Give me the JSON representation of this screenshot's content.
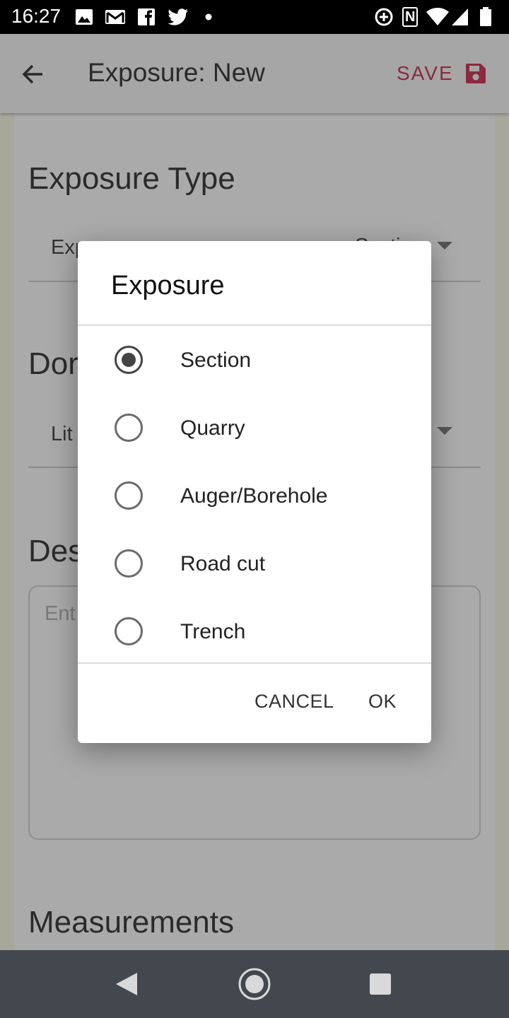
{
  "status_bar": {
    "time": "16:27",
    "left_icons": [
      "image-icon",
      "gmail-icon",
      "facebook-icon",
      "twitter-icon",
      "dot-icon"
    ],
    "right_icons": [
      "data-saver-icon",
      "nfc-icon",
      "wifi-icon",
      "signal-icon",
      "battery-icon"
    ],
    "nfc_glyph": "N"
  },
  "app_bar": {
    "title": "Exposure: New",
    "save_label": "SAVE",
    "accent_color": "#8b2a3c"
  },
  "page": {
    "exposure_type_title": "Exposure Type",
    "exposure_field_label": "Exp",
    "exposure_field_value": "Section",
    "dominant_title": "Dor",
    "dominant_field_value": "Lit",
    "description_title": "Des",
    "description_placeholder": "Ent",
    "measurements_title": "Measurements"
  },
  "dialog": {
    "title": "Exposure",
    "options": [
      {
        "label": "Section",
        "selected": true
      },
      {
        "label": "Quarry",
        "selected": false
      },
      {
        "label": "Auger/Borehole",
        "selected": false
      },
      {
        "label": "Road cut",
        "selected": false
      },
      {
        "label": "Trench",
        "selected": false
      }
    ],
    "cancel_label": "CANCEL",
    "ok_label": "OK"
  },
  "nav_bar": {
    "icons": [
      "back-triangle-icon",
      "home-circle-icon",
      "recents-square-icon"
    ]
  }
}
